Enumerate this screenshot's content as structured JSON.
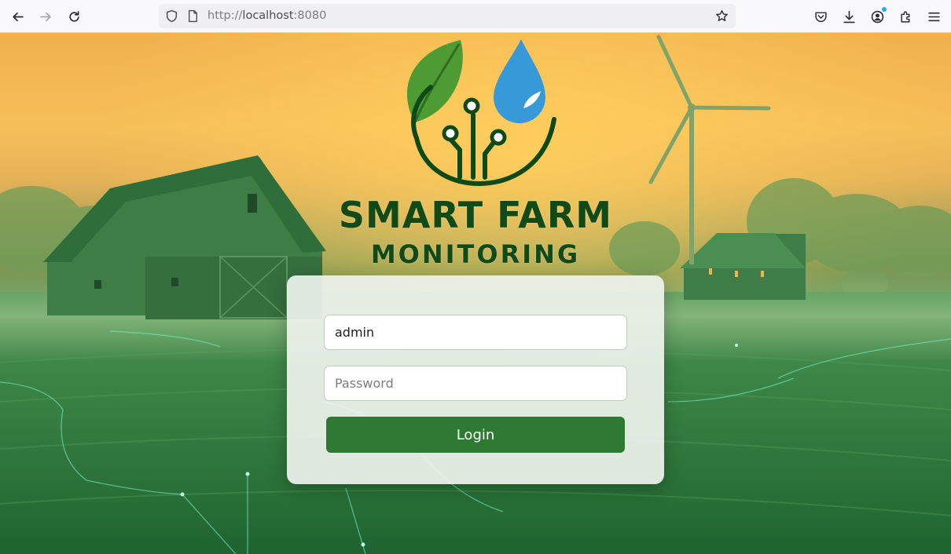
{
  "browser": {
    "url_scheme": "http://",
    "url_host": "localhost",
    "url_port": ":8080",
    "icons": [
      "back-arrow-icon",
      "forward-arrow-icon",
      "reload-icon",
      "shield-icon",
      "page-icon",
      "bookmark-star-icon",
      "pocket-icon",
      "download-icon",
      "account-icon",
      "extensions-icon",
      "menu-icon"
    ]
  },
  "brand": {
    "title_line1": "SMART FARM",
    "title_line2": "MONITORING",
    "color": "#114a17"
  },
  "login": {
    "username_value": "admin",
    "password_placeholder": "Password",
    "button_label": "Login",
    "button_color": "#2f7a33"
  }
}
